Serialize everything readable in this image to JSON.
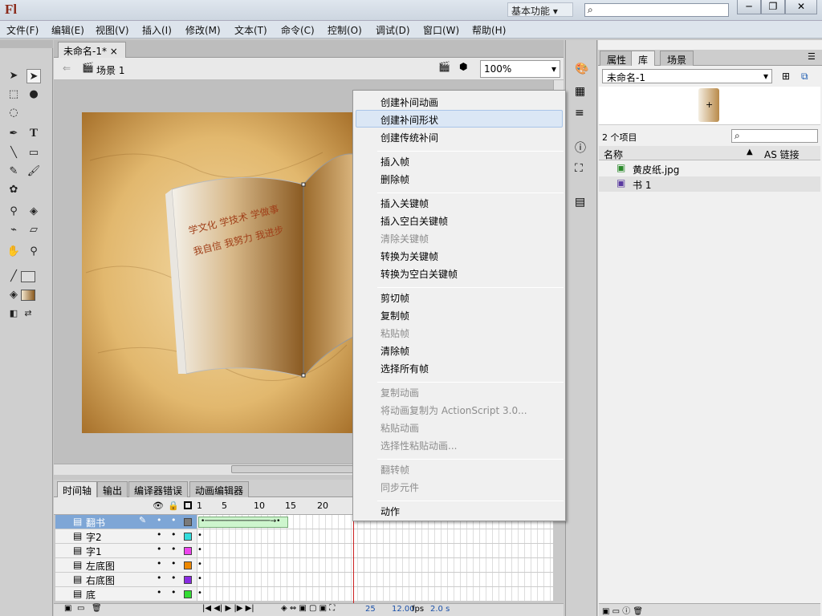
{
  "app": {
    "logo": "Fl",
    "workspace": "基本功能"
  },
  "menubar": [
    "文件(F)",
    "编辑(E)",
    "视图(V)",
    "插入(I)",
    "修改(M)",
    "文本(T)",
    "命令(C)",
    "控制(O)",
    "调试(D)",
    "窗口(W)",
    "帮助(H)"
  ],
  "document": {
    "tab": "未命名-1*",
    "scene": "场景 1",
    "zoom": "100%"
  },
  "book_text": {
    "line1": "学文化  学技术  学做事",
    "line2": "我自信  我努力  我进步"
  },
  "timeline": {
    "tabs": [
      "时间轴",
      "输出",
      "编译器错误",
      "动画编辑器"
    ],
    "frame_numbers": [
      "1",
      "5",
      "10",
      "15",
      "20"
    ],
    "layers": [
      {
        "name": "翻书",
        "color": "#7a7a7a"
      },
      {
        "name": "字2",
        "color": "#33dddd"
      },
      {
        "name": "字1",
        "color": "#ee44ee"
      },
      {
        "name": "左底图",
        "color": "#ee8800"
      },
      {
        "name": "右底图",
        "color": "#8a2be2"
      },
      {
        "name": "底",
        "color": "#33dd33"
      }
    ],
    "current_frame": "25",
    "fps": "12.00",
    "fps_unit": "fps",
    "time": "2.0 s"
  },
  "right_panel": {
    "tabs": [
      "属性",
      "库",
      "场景"
    ],
    "library_doc": "未命名-1",
    "item_count": "2 个项目",
    "col_name": "名称",
    "col_link": "AS 链接",
    "items": [
      "黄皮纸.jpg",
      "书 1"
    ]
  },
  "context_menu": {
    "groups": [
      [
        {
          "label": "创建补间动画",
          "enabled": true
        },
        {
          "label": "创建补间形状",
          "enabled": true
        },
        {
          "label": "创建传统补间",
          "enabled": true
        }
      ],
      [
        {
          "label": "插入帧",
          "enabled": true
        },
        {
          "label": "删除帧",
          "enabled": true
        }
      ],
      [
        {
          "label": "插入关键帧",
          "enabled": true
        },
        {
          "label": "插入空白关键帧",
          "enabled": true
        },
        {
          "label": "清除关键帧",
          "enabled": false
        },
        {
          "label": "转换为关键帧",
          "enabled": true
        },
        {
          "label": "转换为空白关键帧",
          "enabled": true
        }
      ],
      [
        {
          "label": "剪切帧",
          "enabled": true
        },
        {
          "label": "复制帧",
          "enabled": true
        },
        {
          "label": "粘贴帧",
          "enabled": false
        },
        {
          "label": "清除帧",
          "enabled": true
        },
        {
          "label": "选择所有帧",
          "enabled": true
        }
      ],
      [
        {
          "label": "复制动画",
          "enabled": false
        },
        {
          "label": "将动画复制为 ActionScript 3.0...",
          "enabled": false
        },
        {
          "label": "粘贴动画",
          "enabled": false
        },
        {
          "label": "选择性粘贴动画...",
          "enabled": false
        }
      ],
      [
        {
          "label": "翻转帧",
          "enabled": false
        },
        {
          "label": "同步元件",
          "enabled": false
        }
      ],
      [
        {
          "label": "动作",
          "enabled": true
        }
      ]
    ],
    "highlighted": "创建补间形状"
  }
}
